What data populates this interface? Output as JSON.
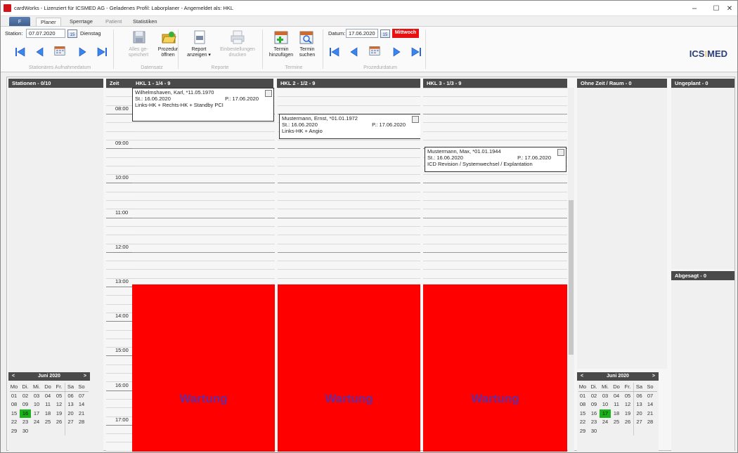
{
  "window": {
    "title": "cardWorks - Lizenziert für ICSMED AG - Geladenes Profil: Laborplaner - Angemeldet als: HKL",
    "controls": {
      "minimize": "–",
      "maximize": "☐",
      "close": "✕"
    }
  },
  "ribbon_tabs": {
    "file": "F",
    "tabs": [
      {
        "label": "Planer",
        "active": true
      },
      {
        "label": "Sperrtage",
        "active": false
      },
      {
        "label": "Patient",
        "active": false,
        "dimmed": true
      },
      {
        "label": "Statistiken",
        "active": false
      }
    ]
  },
  "ribbon": {
    "station_label": "Station:",
    "station_date": "07.07.2020",
    "calendar_icon_text": "15",
    "station_weekday": "Dienstag",
    "group_station": "Stationäres Aufnahmedatum",
    "save_all": [
      "Alles ge-",
      "speichert"
    ],
    "open_procedure": [
      "Prozedur",
      "öffnen"
    ],
    "group_datensatz": "Datensatz",
    "report_show": [
      "Report",
      "anzeigen ▾"
    ],
    "orders_print": [
      "Einbestellungen",
      "drucken"
    ],
    "group_reporte": "Reporte",
    "add_appointment": [
      "Termin",
      "hinzufügen"
    ],
    "search_appointment": [
      "Termin",
      "suchen"
    ],
    "group_termine": "Termine",
    "date_label": "Datum:",
    "procedure_date": "17.06.2020",
    "procedure_weekday": "Mittwoch",
    "group_prozedur": "Prozedurdatum",
    "logo_left": "ICS",
    "logo_right": "MED"
  },
  "columns": {
    "stations": "Stationen - 0/10",
    "time": "Zeit",
    "rooms": [
      "HKL 1 - 1/4 - 9",
      "HKL 2 - 1/2 - 9",
      "HKL 3 - 1/3 - 9"
    ],
    "no_time": "Ohne Zeit / Raum   - 0",
    "unplanned": "Ungeplant   - 0",
    "cancelled": "Abgesagt   - 0"
  },
  "times": [
    "08:00",
    "09:00",
    "10:00",
    "11:00",
    "12:00",
    "13:00",
    "14:00",
    "15:00",
    "16:00",
    "17:00"
  ],
  "appointments": [
    {
      "name": "Wilhelmshaven, Karl, *11.05.1970",
      "station": "St.: 16.06.2020",
      "procedure": "P.: 17.06.2020",
      "description": "Links-HK + Rechts-HK + Standby PCI"
    },
    {
      "name": "Mustermann, Ernst, *01.01.1972",
      "station": "St.: 16.06.2020",
      "procedure": "P.: 17.06.2020",
      "description": "Links-HK + Angio"
    },
    {
      "name": "Mustermann, Max, *01.01.1944",
      "station": "St.: 16.06.2020",
      "procedure": "P.: 17.06.2020",
      "description": "ICD Revision / Systemwechsel / Explantation"
    }
  ],
  "maintenance_label": "Wartung",
  "calendar_left": {
    "month": "Juni 2020",
    "prev": "<",
    "next": ">",
    "weekdays": [
      "Mo",
      "Di.",
      "Mi.",
      "Do",
      "Fr.",
      "Sa",
      "So"
    ],
    "weeks": [
      [
        "01",
        "02",
        "03",
        "04",
        "05",
        "06",
        "07"
      ],
      [
        "08",
        "09",
        "10",
        "11",
        "12",
        "13",
        "14"
      ],
      [
        "15",
        "16",
        "17",
        "18",
        "19",
        "20",
        "21"
      ],
      [
        "22",
        "23",
        "24",
        "25",
        "26",
        "27",
        "28"
      ],
      [
        "29",
        "30",
        "",
        "",
        "",
        "",
        ""
      ]
    ],
    "selected": "16"
  },
  "calendar_right": {
    "month": "Juni 2020",
    "prev": "<",
    "next": ">",
    "weekdays": [
      "Mo",
      "Di.",
      "Mi.",
      "Do",
      "Fr.",
      "Sa",
      "So"
    ],
    "weeks": [
      [
        "01",
        "02",
        "03",
        "04",
        "05",
        "06",
        "07"
      ],
      [
        "08",
        "09",
        "10",
        "11",
        "12",
        "13",
        "14"
      ],
      [
        "15",
        "16",
        "17",
        "18",
        "19",
        "20",
        "21"
      ],
      [
        "22",
        "23",
        "24",
        "25",
        "26",
        "27",
        "28"
      ],
      [
        "29",
        "30",
        "",
        "",
        "",
        "",
        ""
      ]
    ],
    "selected": "17"
  },
  "colors": {
    "maintenance": "#ff0000",
    "maintenance_text": "#6a2a9a",
    "selected_day": "#19b219",
    "header_bg": "#4a4a4a",
    "weekday_badge": "#e81010"
  }
}
